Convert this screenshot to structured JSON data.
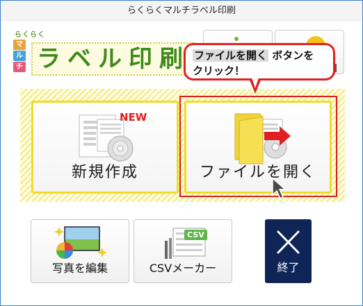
{
  "window": {
    "title": "らくらくマルチラベル印刷"
  },
  "logo": {
    "small": "らくらく",
    "vertical": [
      "マ",
      "ル",
      "チ"
    ],
    "main": "ラベル印刷",
    "colors": [
      "#e8a33a",
      "#4aa0d8",
      "#e85a7a"
    ]
  },
  "callout": {
    "highlight": "ファイルを開く",
    "text_rest": " ボタンを",
    "line2": "クリック！"
  },
  "buttons": {
    "new": {
      "label": "新規作成",
      "badge": "NEW"
    },
    "open": {
      "label": "ファイルを開く"
    },
    "photo": {
      "label": "写真を編集"
    },
    "csv": {
      "label": "CSVメーカー",
      "badge": "CSV"
    },
    "exit": {
      "label": "終了"
    }
  },
  "colors": {
    "accent_red": "#d81e1e",
    "highlight_yellow": "#f0dc28",
    "exit_navy": "#0f2457",
    "logo_green": "#3d8b1c"
  }
}
